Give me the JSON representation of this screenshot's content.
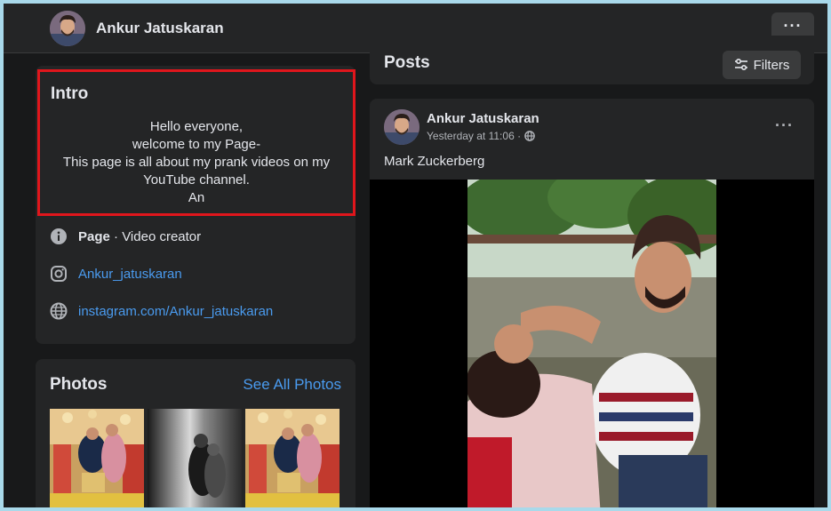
{
  "header": {
    "page_name": "Ankur Jatuskaran",
    "more_label": "···"
  },
  "intro": {
    "title": "Intro",
    "bio_lines": [
      "Hello everyone,",
      "welcome to my Page-",
      "This page is all about my prank videos on my",
      "YouTube channel.",
      "An"
    ],
    "category_prefix": "Page",
    "category_separator": " · ",
    "category": "Video creator",
    "instagram_handle": "Ankur_jatuskaran",
    "website": "instagram.com/Ankur_jatuskaran"
  },
  "photos": {
    "title": "Photos",
    "see_all": "See All Photos"
  },
  "posts": {
    "title": "Posts",
    "filters_label": "Filters"
  },
  "post": {
    "author": "Ankur Jatuskaran",
    "time": "Yesterday at 11:06 ·",
    "audience_icon": "globe-icon",
    "more_label": "···",
    "text": "Mark Zuckerberg"
  },
  "colors": {
    "background": "#18191a",
    "card": "#242526",
    "link": "#4a9bef",
    "highlight_border": "#e0161c",
    "outer_frame": "#a9d9ea"
  }
}
